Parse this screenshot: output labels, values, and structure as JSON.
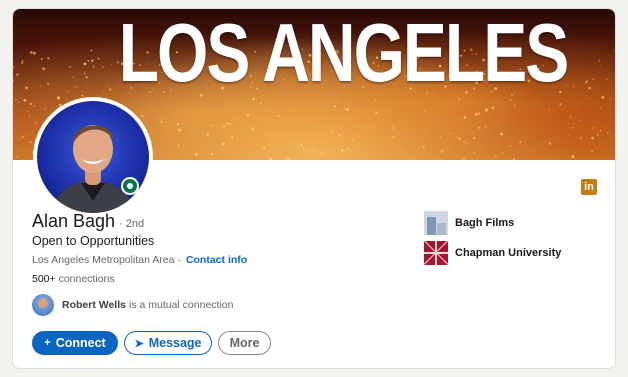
{
  "banner": {
    "title": "LOS ANGELES"
  },
  "profile": {
    "name": "Alan Bagh",
    "degree": "· 2nd",
    "headline": "Open to Opportunities",
    "location": "Los Angeles Metropolitan Area",
    "separator": "·",
    "contact_info": "Contact info",
    "connections_count": "500+",
    "connections_label": "connections",
    "mutual_name": "Robert Wells",
    "mutual_text": "is a mutual connection",
    "linkedin_icon": "in"
  },
  "actions": {
    "connect_label": "Connect",
    "connect_icon": "+",
    "message_label": "Message",
    "message_icon": "➤",
    "more_label": "More"
  },
  "organizations": [
    {
      "name": "Bagh Films"
    },
    {
      "name": "Chapman University"
    }
  ],
  "colors": {
    "accent": "#0a66c2",
    "online": "#01754f",
    "linkedin_badge": "#c37d16"
  }
}
